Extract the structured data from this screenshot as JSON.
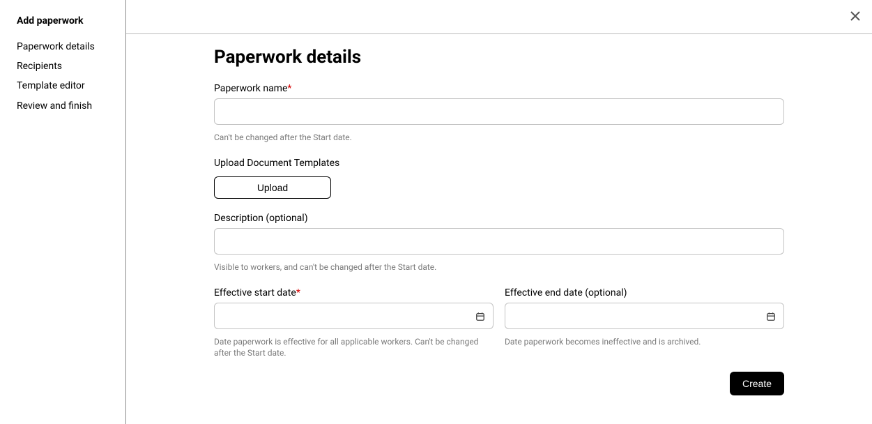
{
  "sidebar": {
    "title": "Add paperwork",
    "items": [
      {
        "label": "Paperwork details"
      },
      {
        "label": "Recipients"
      },
      {
        "label": "Template editor"
      },
      {
        "label": "Review and finish"
      }
    ]
  },
  "page": {
    "heading": "Paperwork details"
  },
  "form": {
    "paperwork_name": {
      "label": "Paperwork name",
      "required_marker": "*",
      "value": "",
      "helper": "Can't be changed after the Start date."
    },
    "upload": {
      "label": "Upload Document Templates",
      "button_label": "Upload"
    },
    "description": {
      "label": "Description (optional)",
      "value": "",
      "helper": "Visible to workers, and can't be changed after the Start date."
    },
    "start_date": {
      "label": "Effective start date",
      "required_marker": "*",
      "value": "",
      "helper": "Date paperwork is effective for all applicable workers. Can't be changed after the Start date."
    },
    "end_date": {
      "label": "Effective end date (optional)",
      "value": "",
      "helper": "Date paperwork becomes ineffective and is archived."
    }
  },
  "actions": {
    "create_label": "Create"
  }
}
